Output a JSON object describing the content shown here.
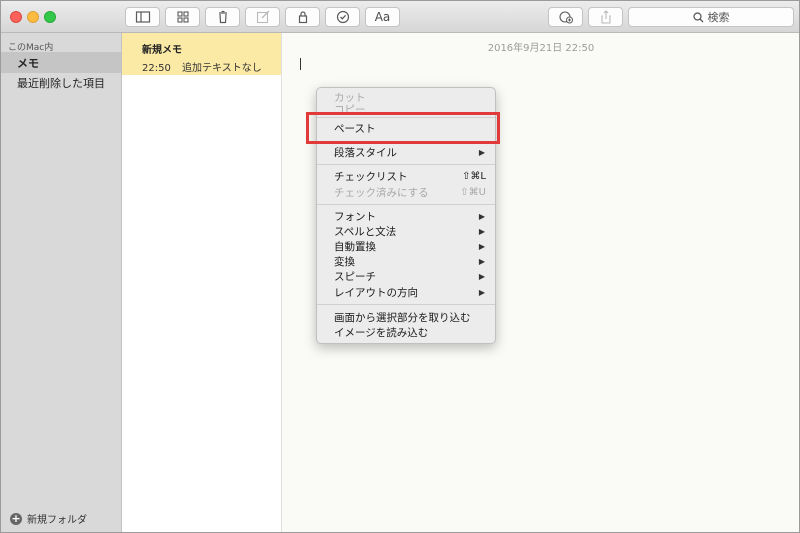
{
  "search": {
    "label": "検索"
  },
  "sidebar": {
    "section": "このMac内",
    "items": [
      {
        "label": "メモ",
        "selected": true
      },
      {
        "label": "最近削除した項目",
        "selected": false
      }
    ],
    "new_folder": "新規フォルダ"
  },
  "notes": [
    {
      "title": "新規メモ",
      "time": "22:50",
      "preview": "追加テキストなし"
    }
  ],
  "editor": {
    "date": "2016年9月21日 22:50"
  },
  "context_menu": {
    "cut": "カット",
    "copy": "コピー",
    "paste": "ペースト",
    "paragraph_style": "段落スタイル",
    "checklist": "チェックリスト",
    "checklist_shortcut": "⇧⌘L",
    "mark_checked": "チェック済みにする",
    "mark_checked_shortcut": "⇧⌘U",
    "font": "フォント",
    "spelling": "スペルと文法",
    "substitutions": "自動置換",
    "transformations": "変換",
    "speech": "スピーチ",
    "layout_direction": "レイアウトの方向",
    "capture_selection": "画面から選択部分を取り込む",
    "import_image": "イメージを読み込む"
  },
  "toolbar": {
    "format_label": "Aa"
  },
  "colors": {
    "highlight": "#e03a3a",
    "note_selected": "#fbe9a6",
    "sidebar": "#d9d9d9"
  }
}
